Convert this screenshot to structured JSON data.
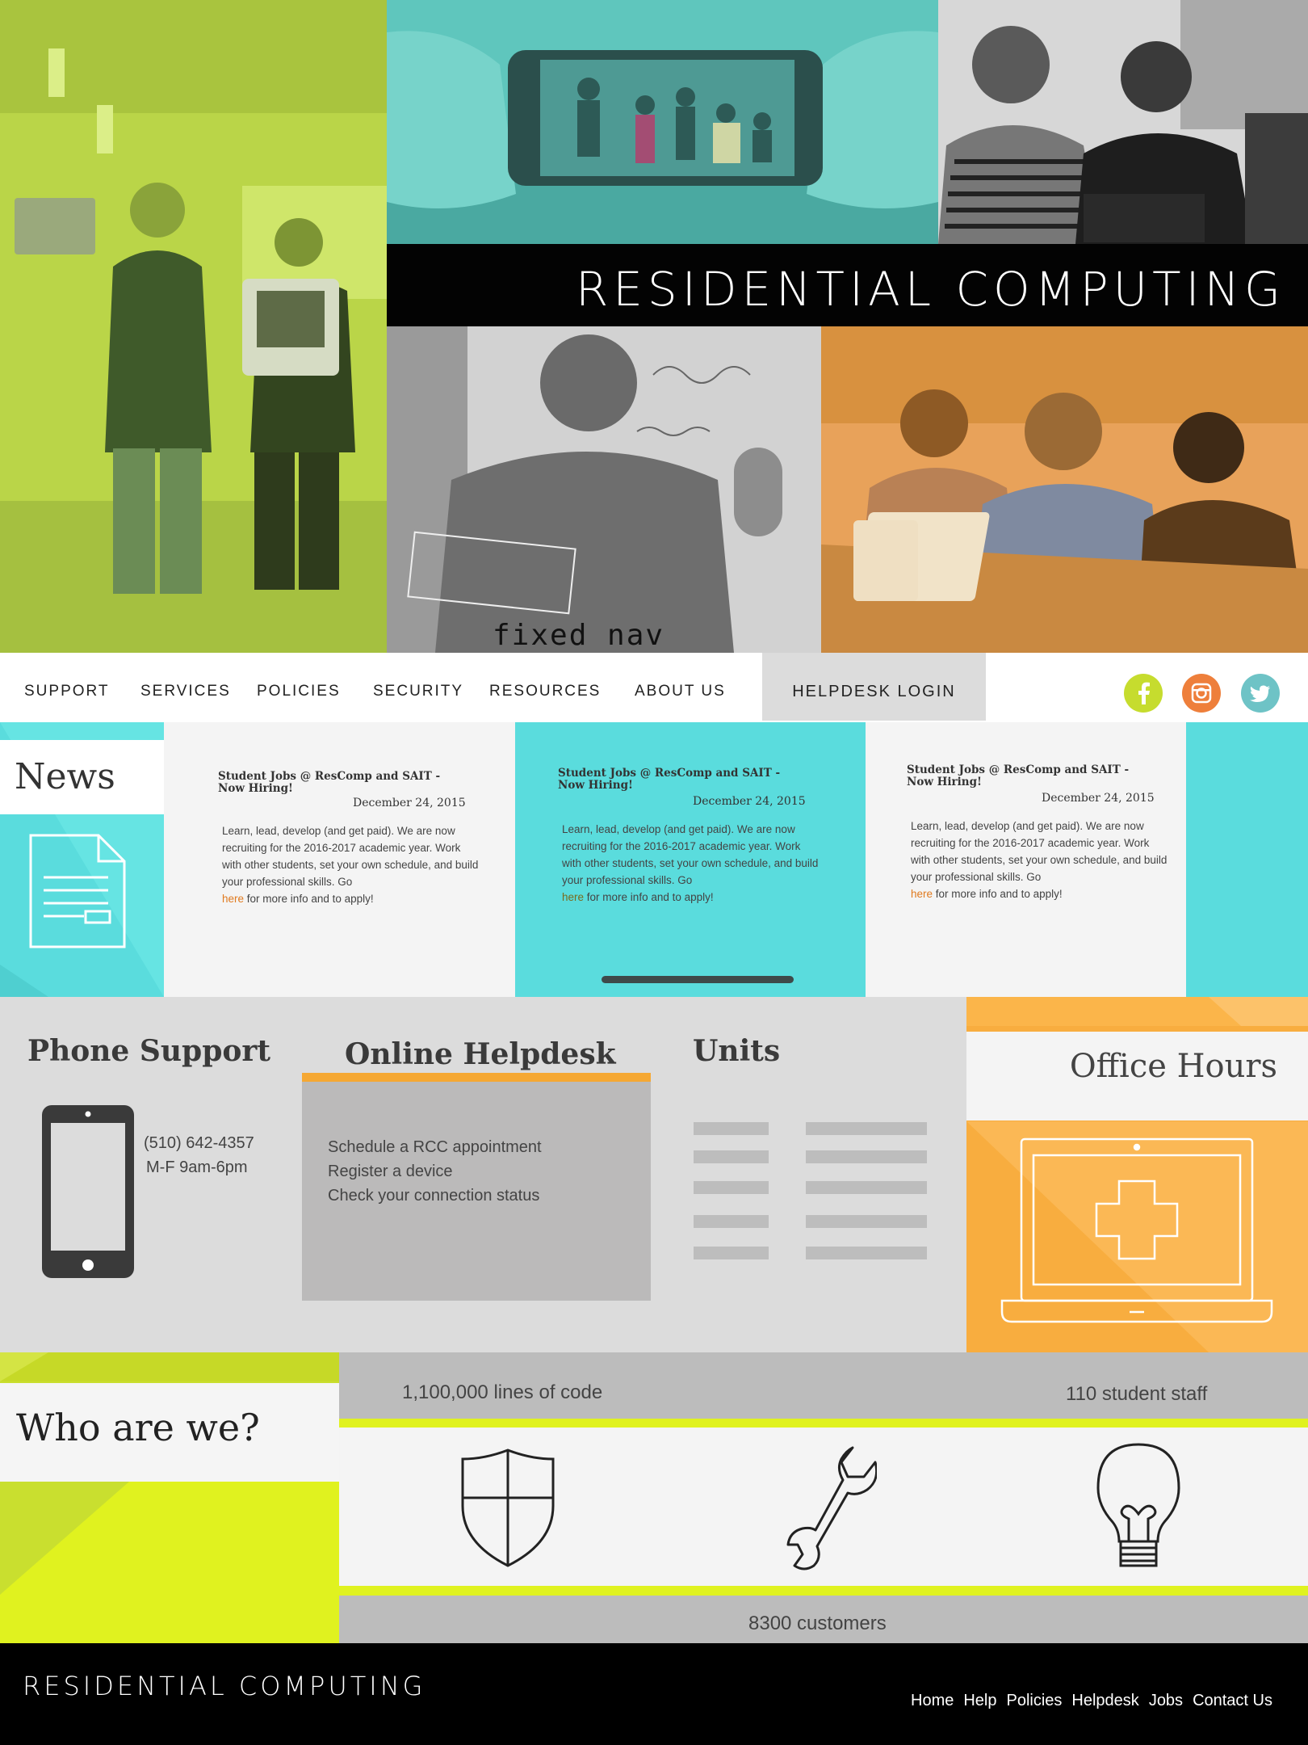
{
  "brand": {
    "name": "RESIDENTIAL COMPUTING"
  },
  "annotation": {
    "fixed_nav": "fixed nav"
  },
  "nav": {
    "items": [
      "SUPPORT",
      "SERVICES",
      "POLICIES",
      "SECURITY",
      "RESOURCES",
      "ABOUT US"
    ],
    "login": "HELPDESK LOGIN",
    "social": [
      "facebook-icon",
      "instagram-icon",
      "twitter-icon"
    ]
  },
  "news": {
    "label": "News",
    "cards": [
      {
        "title": "Student Jobs @ ResComp and SAIT - Now Hiring!",
        "date": "December 24, 2015",
        "body": "Learn, lead, develop (and get paid). We are now recruiting for the 2016-2017 academic year. Work with other students, set your own schedule, and build your professional skills. Go",
        "link": "here",
        "tail": "for more info and to apply!"
      },
      {
        "title": "Student Jobs @ ResComp and SAIT - Now Hiring!",
        "date": "December 24, 2015",
        "body": "Learn, lead, develop (and get paid). We are now recruiting for the 2016-2017 academic year. Work with other students, set your own schedule, and build your professional skills. Go",
        "link": "here",
        "tail": "for more info and to apply!"
      },
      {
        "title": "Student Jobs @ ResComp and SAIT - Now Hiring!",
        "date": "December 24, 2015",
        "body": "Learn, lead, develop (and get paid). We are now recruiting for the 2016-2017 academic year. Work with other students, set your own schedule, and build your professional skills. Go",
        "link": "here",
        "tail": "for more info and to apply!"
      }
    ]
  },
  "services": {
    "phone": {
      "title": "Phone Support",
      "number": "(510) 642-4357",
      "hours": "M-F 9am-6pm"
    },
    "helpdesk": {
      "title": "Online Helpdesk",
      "links": [
        "Schedule a RCC appointment",
        "Register a device",
        "Check your connection status"
      ]
    },
    "units": {
      "title": "Units"
    },
    "office": {
      "title": "Office Hours"
    }
  },
  "who": {
    "label": "Who are we?",
    "stats": {
      "code": "1,100,000 lines of code",
      "staff": "110 student staff",
      "customers": "8300 customers"
    }
  },
  "footer": {
    "brand": "RESIDENTIAL COMPUTING",
    "links": [
      "Home",
      "Help",
      "Policies",
      "Helpdesk",
      "Jobs",
      "Contact Us"
    ]
  },
  "colors": {
    "lime": "#c6e02f",
    "teal": "#5adcdd",
    "orange": "#f5a833",
    "gray": "#dcdcdc",
    "black": "#000000"
  }
}
